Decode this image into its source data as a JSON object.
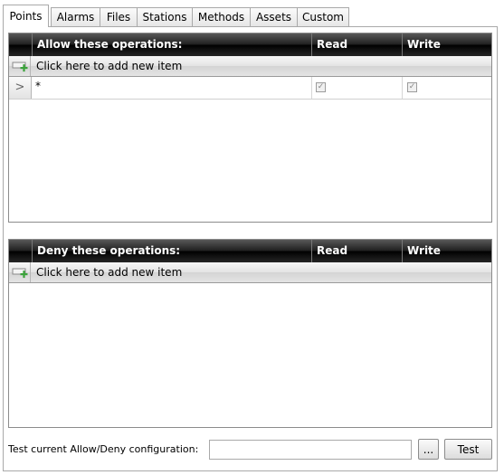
{
  "tabs": [
    "Points",
    "Alarms",
    "Files",
    "Stations",
    "Methods",
    "Assets",
    "Custom"
  ],
  "active_tab": "Points",
  "allow_grid": {
    "columns": [
      "Allow these operations:",
      "Read",
      "Write"
    ],
    "add_new_item": "Click here to add new item",
    "rows": [
      {
        "indicator": ">",
        "operation": "*",
        "read": true,
        "write": true
      }
    ]
  },
  "deny_grid": {
    "columns": [
      "Deny these operations:",
      "Read",
      "Write"
    ],
    "add_new_item": "Click here to add new item",
    "rows": []
  },
  "test": {
    "label": "Test current Allow/Deny configuration:",
    "input_value": "",
    "browse_label": "...",
    "test_label": "Test"
  },
  "icons": {
    "add_row": "add-row-icon",
    "row_indicator": "row-indicator-icon",
    "checkbox": "checkbox-checked-icon"
  }
}
